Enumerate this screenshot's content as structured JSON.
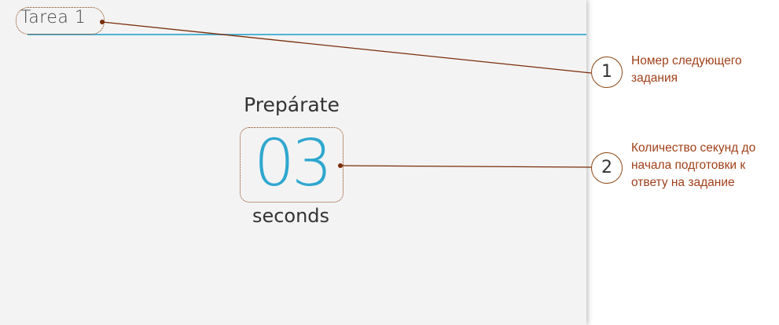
{
  "screen": {
    "task_title": "Tarea 1",
    "prepare_label": "Prepárate",
    "countdown_value": "03",
    "seconds_label": "seconds",
    "accent_color": "#2fa7cf"
  },
  "annotations": [
    {
      "number": "1",
      "line1": "Номер следующего",
      "line2": "задания"
    },
    {
      "number": "2",
      "line1": "Количество секунд до",
      "line2": "начала подготовки к",
      "line3": "ответу на задание"
    }
  ],
  "annotation_color": "#8b4513"
}
